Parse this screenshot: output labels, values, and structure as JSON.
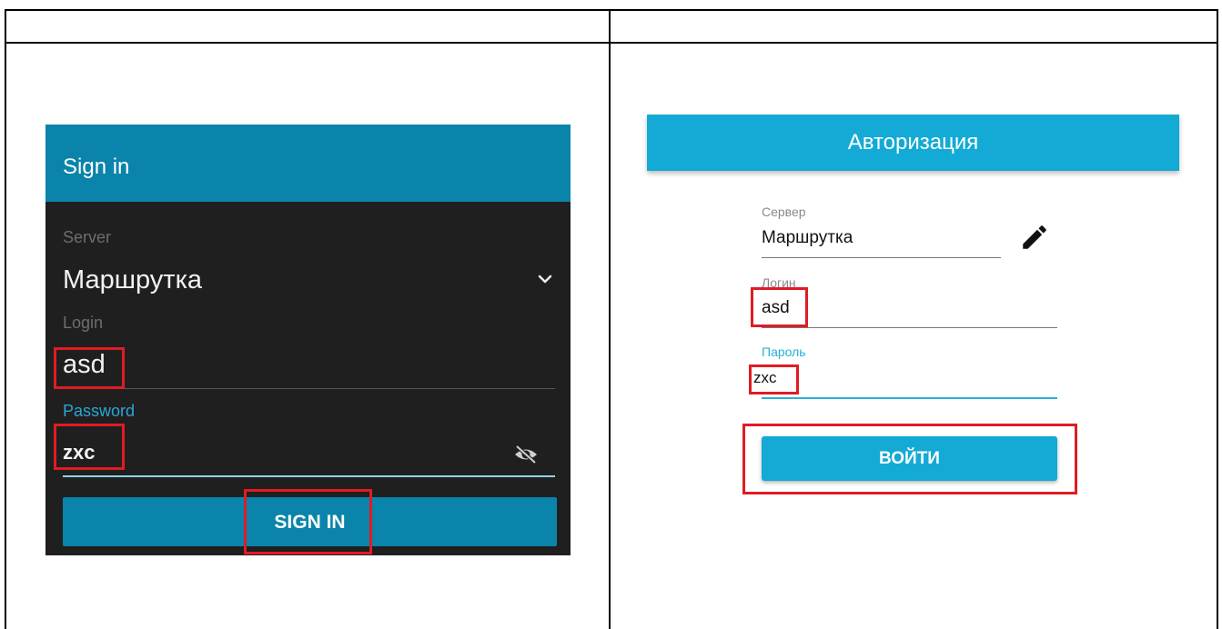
{
  "left_panel": {
    "title": "Sign in",
    "server_label": "Server",
    "server_value": "Маршрутка",
    "login_label": "Login",
    "login_value": "asd",
    "password_label": "Password",
    "password_value": "zxc",
    "sign_in_label": "SIGN IN",
    "colors": {
      "header": "#0a84aa",
      "background": "#1f1f1f",
      "accent": "#2aa6d6"
    },
    "icons": {
      "server_dropdown": "chevron-down-icon",
      "password_visibility": "eye-off-icon"
    }
  },
  "right_panel": {
    "title": "Авторизация",
    "server_label": "Сервер",
    "server_value": "Маршрутка",
    "login_label": "Логин",
    "login_value": "asd",
    "password_label": "Пароль",
    "password_value": "zxc",
    "sign_in_label": "ВОЙТИ",
    "colors": {
      "header": "#13aad6",
      "accent": "#2ab0d8",
      "highlight": "#e01b24"
    },
    "icons": {
      "server_edit": "pencil-icon"
    }
  }
}
